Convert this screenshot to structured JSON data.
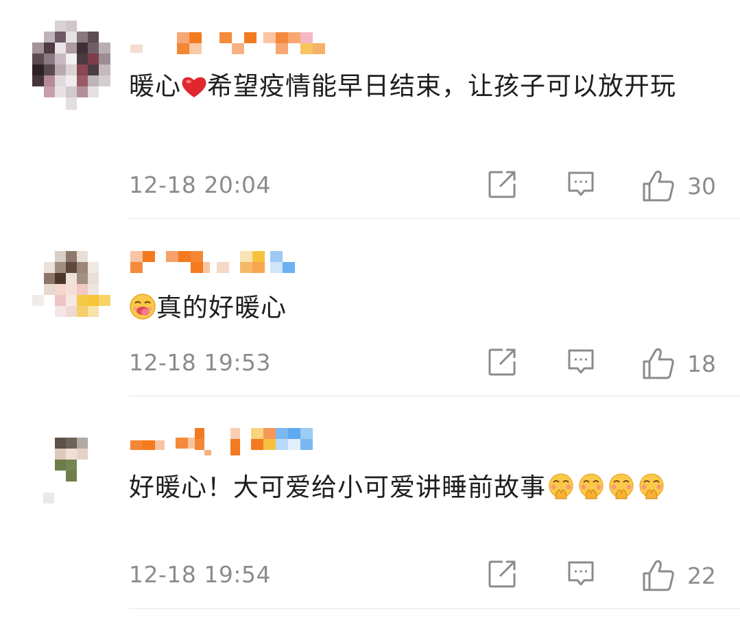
{
  "comments": [
    {
      "text_parts": [
        "暖心",
        "希望疫情能早日结束，让孩子可以放开玩"
      ],
      "emoji_inline": "heart-emoji",
      "time": "12-18 20:04",
      "likes": "30"
    },
    {
      "text": "真的好暖心",
      "emoji_leading": "drooling-face-emoji",
      "time": "12-18 19:53",
      "likes": "18"
    },
    {
      "text": "好暖心！大可爱给小可爱讲睡前故事",
      "emoji_trailing": "blush-hands-emoji",
      "emoji_trailing_count": 4,
      "time": "12-18 19:54",
      "likes": "22"
    }
  ],
  "icons": {
    "share": "share-icon",
    "reply": "comment-icon",
    "like": "thumbs-up-icon"
  },
  "colors": {
    "text": "#1e1e1e",
    "meta": "#8b8b8b",
    "username_accent": "#f47a1f",
    "divider": "#e6e6e6"
  }
}
